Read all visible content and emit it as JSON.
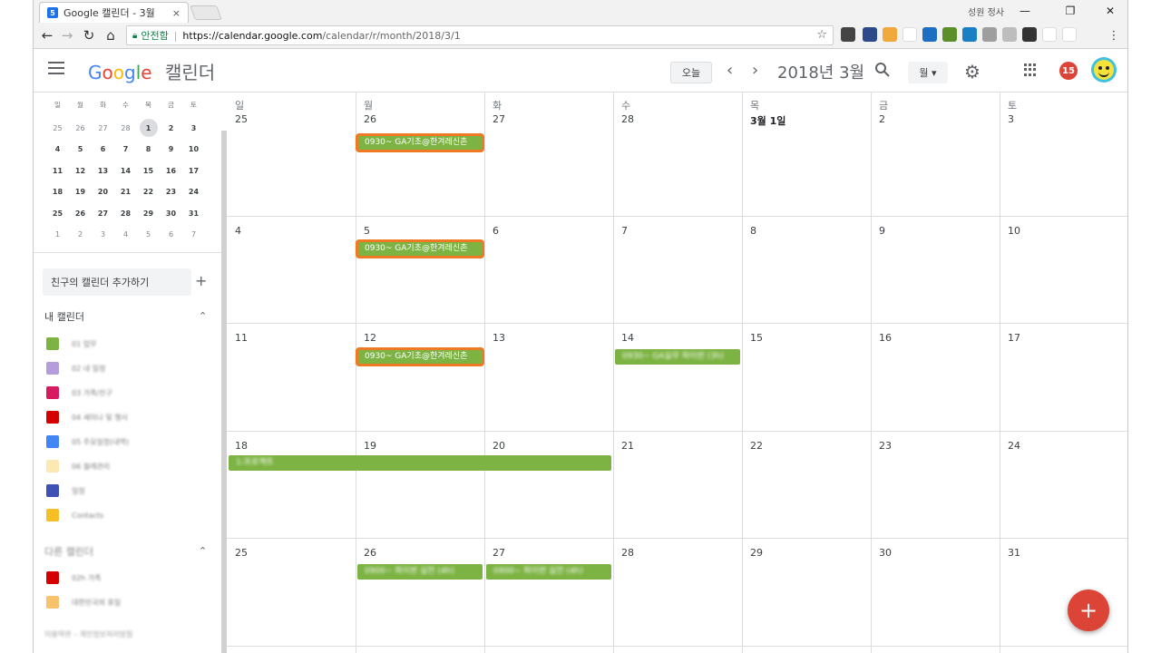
{
  "browser": {
    "tab_title": "Google 캘린더 - 3월",
    "tab_favicon_text": "5",
    "tab_close": "×",
    "window_user": "성원 정사",
    "minimize": "—",
    "restore": "❐",
    "close": "✕",
    "secure_label": "안전함",
    "url_host": "https://calendar.google.com",
    "url_path": "/calendar/r/month/2018/3/1",
    "star": "☆"
  },
  "header": {
    "logo": [
      "G",
      "o",
      "o",
      "g",
      "l",
      "e"
    ],
    "app_name": "캘린더",
    "today_label": "오늘",
    "prev": "‹",
    "next": "›",
    "month_title": "2018년 3월",
    "view_label": "월 ▾",
    "gear": "⚙",
    "notification_count": "15"
  },
  "sidebar": {
    "mini_dow": [
      "일",
      "월",
      "화",
      "수",
      "목",
      "금",
      "토"
    ],
    "mini_weeks": [
      [
        "25",
        "26",
        "27",
        "28",
        "1",
        "2",
        "3"
      ],
      [
        "4",
        "5",
        "6",
        "7",
        "8",
        "9",
        "10"
      ],
      [
        "11",
        "12",
        "13",
        "14",
        "15",
        "16",
        "17"
      ],
      [
        "18",
        "19",
        "20",
        "21",
        "22",
        "23",
        "24"
      ],
      [
        "25",
        "26",
        "27",
        "28",
        "29",
        "30",
        "31"
      ],
      [
        "1",
        "2",
        "3",
        "4",
        "5",
        "6",
        "7"
      ]
    ],
    "add_friend": "친구의 캘린더 추가하기",
    "add_plus": "+",
    "my_calendars_title": "내 캘린더",
    "my_calendars": [
      {
        "label": "01 업무",
        "color": "#7cb342"
      },
      {
        "label": "02 내 일정",
        "color": "#b39ddb"
      },
      {
        "label": "03 가족/친구",
        "color": "#d81b60"
      },
      {
        "label": "04 세미나 및 행사",
        "color": "#d50000"
      },
      {
        "label": "05 주요일정(내역)",
        "color": "#4285f4"
      },
      {
        "label": "06 월례관리",
        "color": "#fce8b2"
      },
      {
        "label": "일정",
        "color": "#3f51b5"
      },
      {
        "label": "Contacts",
        "color": "#f6bf26"
      }
    ],
    "other_calendars_title": "다른 캘린더",
    "other_calendars": [
      {
        "label": "02h 가족",
        "color": "#d50000"
      },
      {
        "label": "대한민국의 휴일",
        "color": "#f6c26b"
      }
    ],
    "footer": "이용약관 – 개인정보처리방침",
    "collapse": "⌃"
  },
  "grid": {
    "dow": [
      "일",
      "월",
      "화",
      "수",
      "목",
      "금",
      "토"
    ],
    "weeks": [
      [
        "25",
        "26",
        "27",
        "28",
        "3월 1일",
        "2",
        "3"
      ],
      [
        "4",
        "5",
        "6",
        "7",
        "8",
        "9",
        "10"
      ],
      [
        "11",
        "12",
        "13",
        "14",
        "15",
        "16",
        "17"
      ],
      [
        "18",
        "19",
        "20",
        "21",
        "22",
        "23",
        "24"
      ],
      [
        "25",
        "26",
        "27",
        "28",
        "29",
        "30",
        "31"
      ]
    ],
    "highlight_event_text": "0930~ GA기초@한겨레신촌",
    "blurred_events": [
      "0930~ GA실무 파이썬 (3h)",
      "1:프로젝트",
      "0900~ 파이썬 실전 (4h)",
      "0900~ 파이썬 실전 (4h)"
    ],
    "event_color": "#7cb342",
    "highlight_color": "#f07a23"
  },
  "fab_label": "+"
}
